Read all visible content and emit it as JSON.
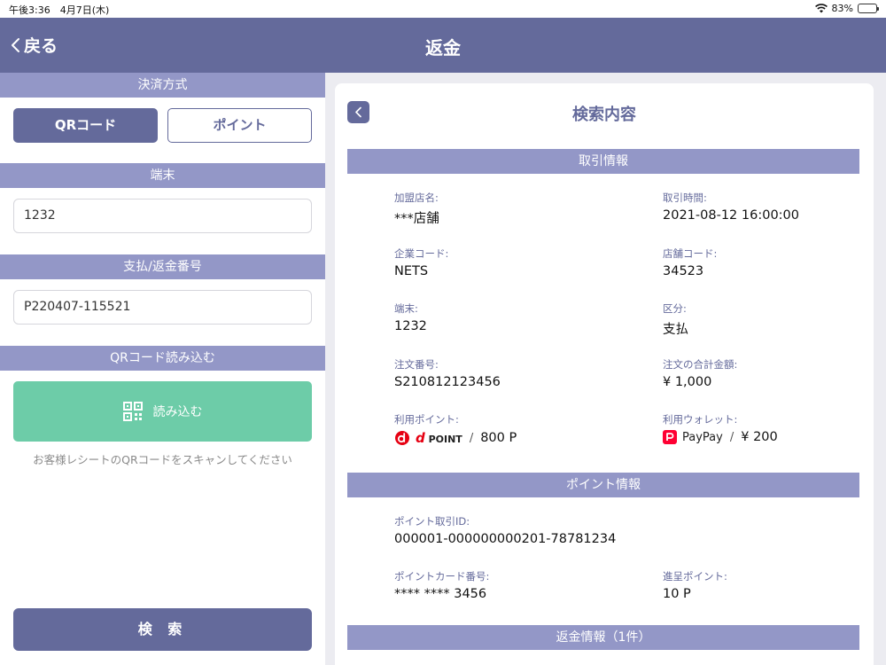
{
  "status": {
    "time": "午後3:36　4月7日(木)",
    "battery": "83%",
    "battery_level": 0.83
  },
  "nav": {
    "back": "戻る",
    "title": "返金"
  },
  "left": {
    "payment_method": {
      "header": "決済方式",
      "options": [
        "QRコード",
        "ポイント"
      ],
      "selected": "QRコード"
    },
    "terminal": {
      "header": "端末",
      "value": "1232"
    },
    "payment_number": {
      "header": "支払/返金番号",
      "value": "P220407-115521"
    },
    "qr_read": {
      "header": "QRコード読み込む",
      "button": "読み込む",
      "hint": "お客様レシートのQRコードをスキャンしてください"
    },
    "search_button": "検 索"
  },
  "panel": {
    "title": "検索内容",
    "transaction": {
      "header": "取引情報",
      "store_name": {
        "label": "加盟店名:",
        "value": "***店舗"
      },
      "time": {
        "label": "取引時間:",
        "value": "2021-08-12 16:00:00"
      },
      "company_code": {
        "label": "企業コード:",
        "value": "NETS"
      },
      "store_code": {
        "label": "店舗コード:",
        "value": "34523"
      },
      "terminal": {
        "label": "端末:",
        "value": "1232"
      },
      "category": {
        "label": "区分:",
        "value": "支払"
      },
      "order_no": {
        "label": "注文番号:",
        "value": "S210812123456"
      },
      "total": {
        "label": "注文の合計金額:",
        "value": "¥ 1,000"
      },
      "points_used": {
        "label": "利用ポイント:",
        "brand_d": "d",
        "brand_word": "POINT",
        "separator": "/",
        "value": "800 P"
      },
      "wallet_used": {
        "label": "利用ウォレット:",
        "brand": "PayPay",
        "separator": "/",
        "value": "¥ 200"
      }
    },
    "point_info": {
      "header": "ポイント情報",
      "txn_id": {
        "label": "ポイント取引ID:",
        "value": "000001-000000000201-78781234"
      },
      "card_no": {
        "label": "ポイントカード番号:",
        "value": "**** **** 3456"
      },
      "gift": {
        "label": "進呈ポイント:",
        "value": "10 P"
      }
    },
    "refund_info": {
      "header": "返金情報（1件）"
    }
  },
  "colors": {
    "primary": "#646a9b",
    "section": "#9397c7",
    "scan": "#6dcca8",
    "dpoint": "#e60012",
    "paypay": "#ff0033"
  }
}
